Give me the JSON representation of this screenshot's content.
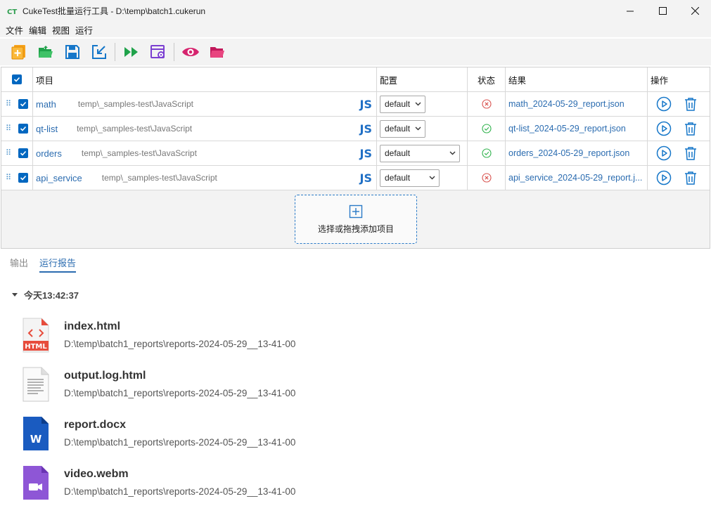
{
  "window": {
    "title": "CukeTest批量运行工具 - D:\\temp\\batch1.cukerun",
    "logo": "CT"
  },
  "menu": [
    "文件",
    "编辑",
    "视图",
    "运行"
  ],
  "toolbar": {
    "icons": [
      "new-file-icon",
      "open-folder-icon",
      "save-icon",
      "export-icon",
      "run-all-icon",
      "run-settings-icon",
      "view-icon",
      "open-reports-folder-icon"
    ]
  },
  "table": {
    "headers": {
      "project": "项目",
      "config": "配置",
      "status": "状态",
      "result": "结果",
      "actions": "操作"
    },
    "rows": [
      {
        "name": "math",
        "path": "temp\\_samples-test\\JavaScript",
        "lang": "JS",
        "config": "default",
        "status": "failed",
        "result": "math_2024-05-29_report.json"
      },
      {
        "name": "qt-list",
        "path": "temp\\_samples-test\\JavaScript",
        "lang": "JS",
        "config": "default",
        "status": "passed",
        "result": "qt-list_2024-05-29_report.json"
      },
      {
        "name": "orders",
        "path": "temp\\_samples-test\\JavaScript",
        "lang": "JS",
        "config": "default",
        "status": "passed",
        "result": "orders_2024-05-29_report.json"
      },
      {
        "name": "api_service",
        "path": "temp\\_samples-test\\JavaScript",
        "lang": "JS",
        "config": "default",
        "status": "failed",
        "result": "api_service_2024-05-29_report.j..."
      }
    ],
    "add_label": "选择或拖拽添加项目"
  },
  "colors": {
    "accent": "#0067c0",
    "link": "#2b6cb0",
    "passed": "#2fb24c",
    "failed": "#d9534f"
  },
  "bottom": {
    "tabs": [
      "输出",
      "运行报告"
    ],
    "active_tab": 1,
    "group": "今天13:42:37",
    "files": [
      {
        "name": "index.html",
        "path": "D:\\temp\\batch1_reports\\reports-2024-05-29__13-41-00",
        "icon": "html-file-icon",
        "icon_label": "HTML"
      },
      {
        "name": "output.log.html",
        "path": "D:\\temp\\batch1_reports\\reports-2024-05-29__13-41-00",
        "icon": "text-file-icon"
      },
      {
        "name": "report.docx",
        "path": "D:\\temp\\batch1_reports\\reports-2024-05-29__13-41-00",
        "icon": "word-file-icon",
        "icon_label": "W"
      },
      {
        "name": "video.webm",
        "path": "D:\\temp\\batch1_reports\\reports-2024-05-29__13-41-00",
        "icon": "video-file-icon"
      }
    ]
  }
}
